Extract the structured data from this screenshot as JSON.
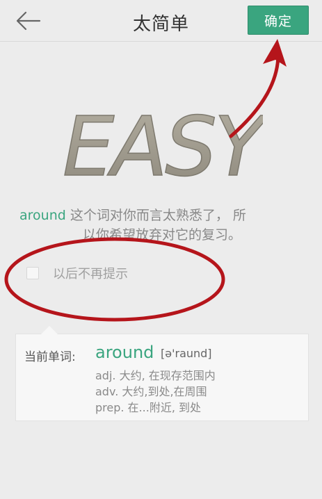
{
  "header": {
    "title": "太简单",
    "confirm_label": "确定"
  },
  "logo": {
    "text": "EASY"
  },
  "description": {
    "word": "around",
    "line1": " 这个词对你而言太熟悉了， 所",
    "line2": "以你希望放弃对它的复习。"
  },
  "option": {
    "label": "以后不再提示",
    "checked": false
  },
  "card": {
    "label": "当前单词:",
    "word": "around",
    "phonetic": "[ə'raund]",
    "definitions": [
      "adj. 大约, 在现存范围内",
      "adv. 大约,到处,在周围",
      "prep. 在...附近, 到处"
    ]
  },
  "colors": {
    "accent": "#3aa57f",
    "annotation": "#b5151b",
    "background": "#ececec"
  },
  "icons": {
    "back": "arrow-left-icon"
  }
}
